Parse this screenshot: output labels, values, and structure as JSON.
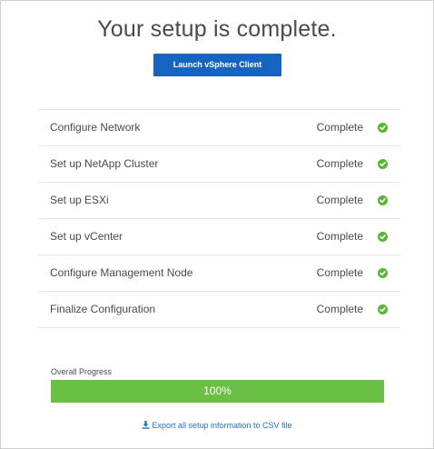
{
  "header": {
    "title": "Your setup is complete.",
    "launch_button_label": "Launch vSphere Client"
  },
  "steps": [
    {
      "label": "Configure Network",
      "status": "Complete",
      "icon": "check-circle-icon"
    },
    {
      "label": "Set up NetApp Cluster",
      "status": "Complete",
      "icon": "check-circle-icon"
    },
    {
      "label": "Set up ESXi",
      "status": "Complete",
      "icon": "check-circle-icon"
    },
    {
      "label": "Set up vCenter",
      "status": "Complete",
      "icon": "check-circle-icon"
    },
    {
      "label": "Configure Management Node",
      "status": "Complete",
      "icon": "check-circle-icon"
    },
    {
      "label": "Finalize Configuration",
      "status": "Complete",
      "icon": "check-circle-icon"
    }
  ],
  "progress": {
    "label": "Overall Progress",
    "value_percent": 100,
    "text": "100%"
  },
  "footer": {
    "export_link_label": "Export all setup information to CSV file",
    "export_icon": "download-icon"
  },
  "colors": {
    "accent_button": "#1565c0",
    "success_green": "#5ab531",
    "progress_fill": "#6abf45",
    "link_blue": "#1e73be",
    "text": "#4a4a4a"
  }
}
